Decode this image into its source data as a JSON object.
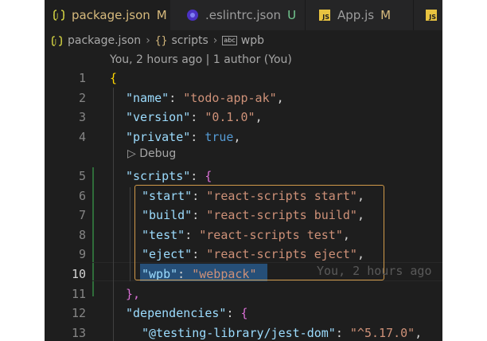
{
  "tabs": [
    {
      "name": "package.json",
      "status": "M",
      "icon": "json-icon",
      "active": true,
      "close": "✕"
    },
    {
      "name": ".eslintrc.json",
      "status": "U",
      "icon": "eslint-icon",
      "active": false
    },
    {
      "name": "App.js",
      "status": "M",
      "icon": "js-icon",
      "active": false
    },
    {
      "name": "",
      "status": "",
      "icon": "js-icon",
      "active": false
    }
  ],
  "breadcrumb": {
    "file": "package.json",
    "section": "scripts",
    "item": "wpb"
  },
  "blame_header": "You, 2 hours ago | 1 author (You)",
  "codelens": "▷ Debug",
  "inline_blame": "You, 2 hours ago",
  "current_line": 10,
  "lines": [
    {
      "n": "1",
      "text": "{"
    },
    {
      "n": "2",
      "text": "\"name\": \"todo-app-ak\","
    },
    {
      "n": "3",
      "text": "\"version\": \"0.1.0\","
    },
    {
      "n": "4",
      "text": "\"private\": true,"
    },
    {
      "n": "5",
      "text": "\"scripts\": {"
    },
    {
      "n": "6",
      "text": "\"start\": \"react-scripts start\","
    },
    {
      "n": "7",
      "text": "\"build\": \"react-scripts build\","
    },
    {
      "n": "8",
      "text": "\"test\": \"react-scripts test\","
    },
    {
      "n": "9",
      "text": "\"eject\": \"react-scripts eject\","
    },
    {
      "n": "10",
      "text": "\"wpb\": \"webpack\""
    },
    {
      "n": "11",
      "text": "},"
    },
    {
      "n": "12",
      "text": "\"dependencies\": {"
    },
    {
      "n": "13",
      "text": "\"@testing-library/jest-dom\": \"^5.17.0\","
    }
  ],
  "colors": {
    "editor_bg": "#1e1e1e",
    "key": "#9cdcfe",
    "string": "#ce9178",
    "bool": "#569cd6",
    "modified": "#d7ba7d",
    "untracked": "#73c991",
    "highlight_box": "#d19a4a",
    "selection": "#264f78"
  }
}
